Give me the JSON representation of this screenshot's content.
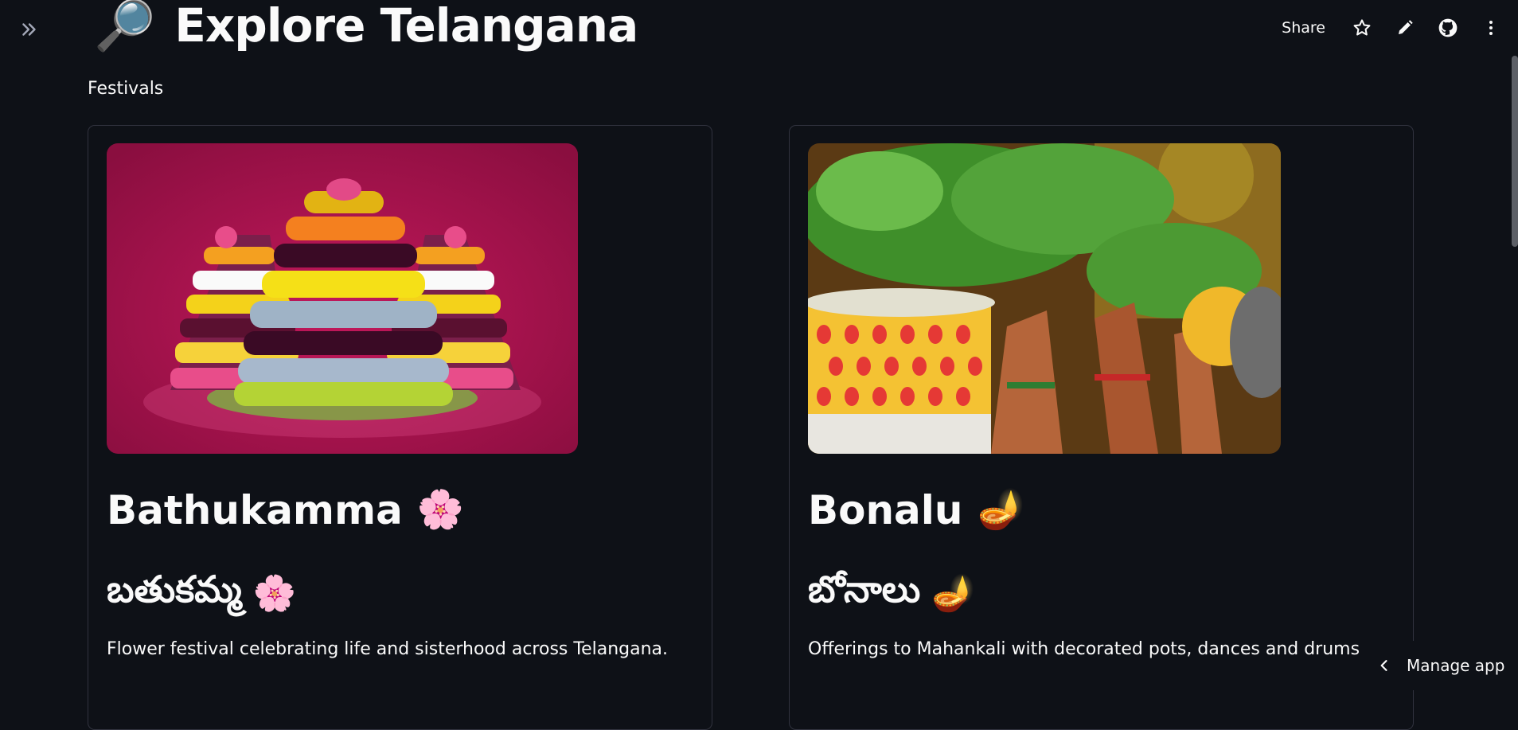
{
  "app": {
    "title_emoji": "🔎",
    "title": "Explore Telangana",
    "section_label": "Festivals"
  },
  "toolbar": {
    "share_label": "Share",
    "icons": [
      "star-icon",
      "pencil-icon",
      "github-icon",
      "kebab-menu-icon"
    ]
  },
  "sidebar_toggle_icon": "double-chevron-right-icon",
  "festivals": [
    {
      "name": "Bathukamma",
      "name_emoji": "🌸",
      "telugu": "బతుకమ్మ",
      "telugu_emoji": "🌸",
      "description": "Flower festival celebrating life and sisterhood across Telangana."
    },
    {
      "name": "Bonalu",
      "name_emoji": "🪔",
      "telugu": "బోనాలు",
      "telugu_emoji": "🪔",
      "description": "Offerings to Mahankali with decorated pots, dances and drums."
    }
  ],
  "manage_app": {
    "label": "Manage app",
    "icon": "chevron-left-icon"
  },
  "colors": {
    "background": "#0e1117",
    "text": "#fafafa",
    "card_border": "#31333f"
  }
}
